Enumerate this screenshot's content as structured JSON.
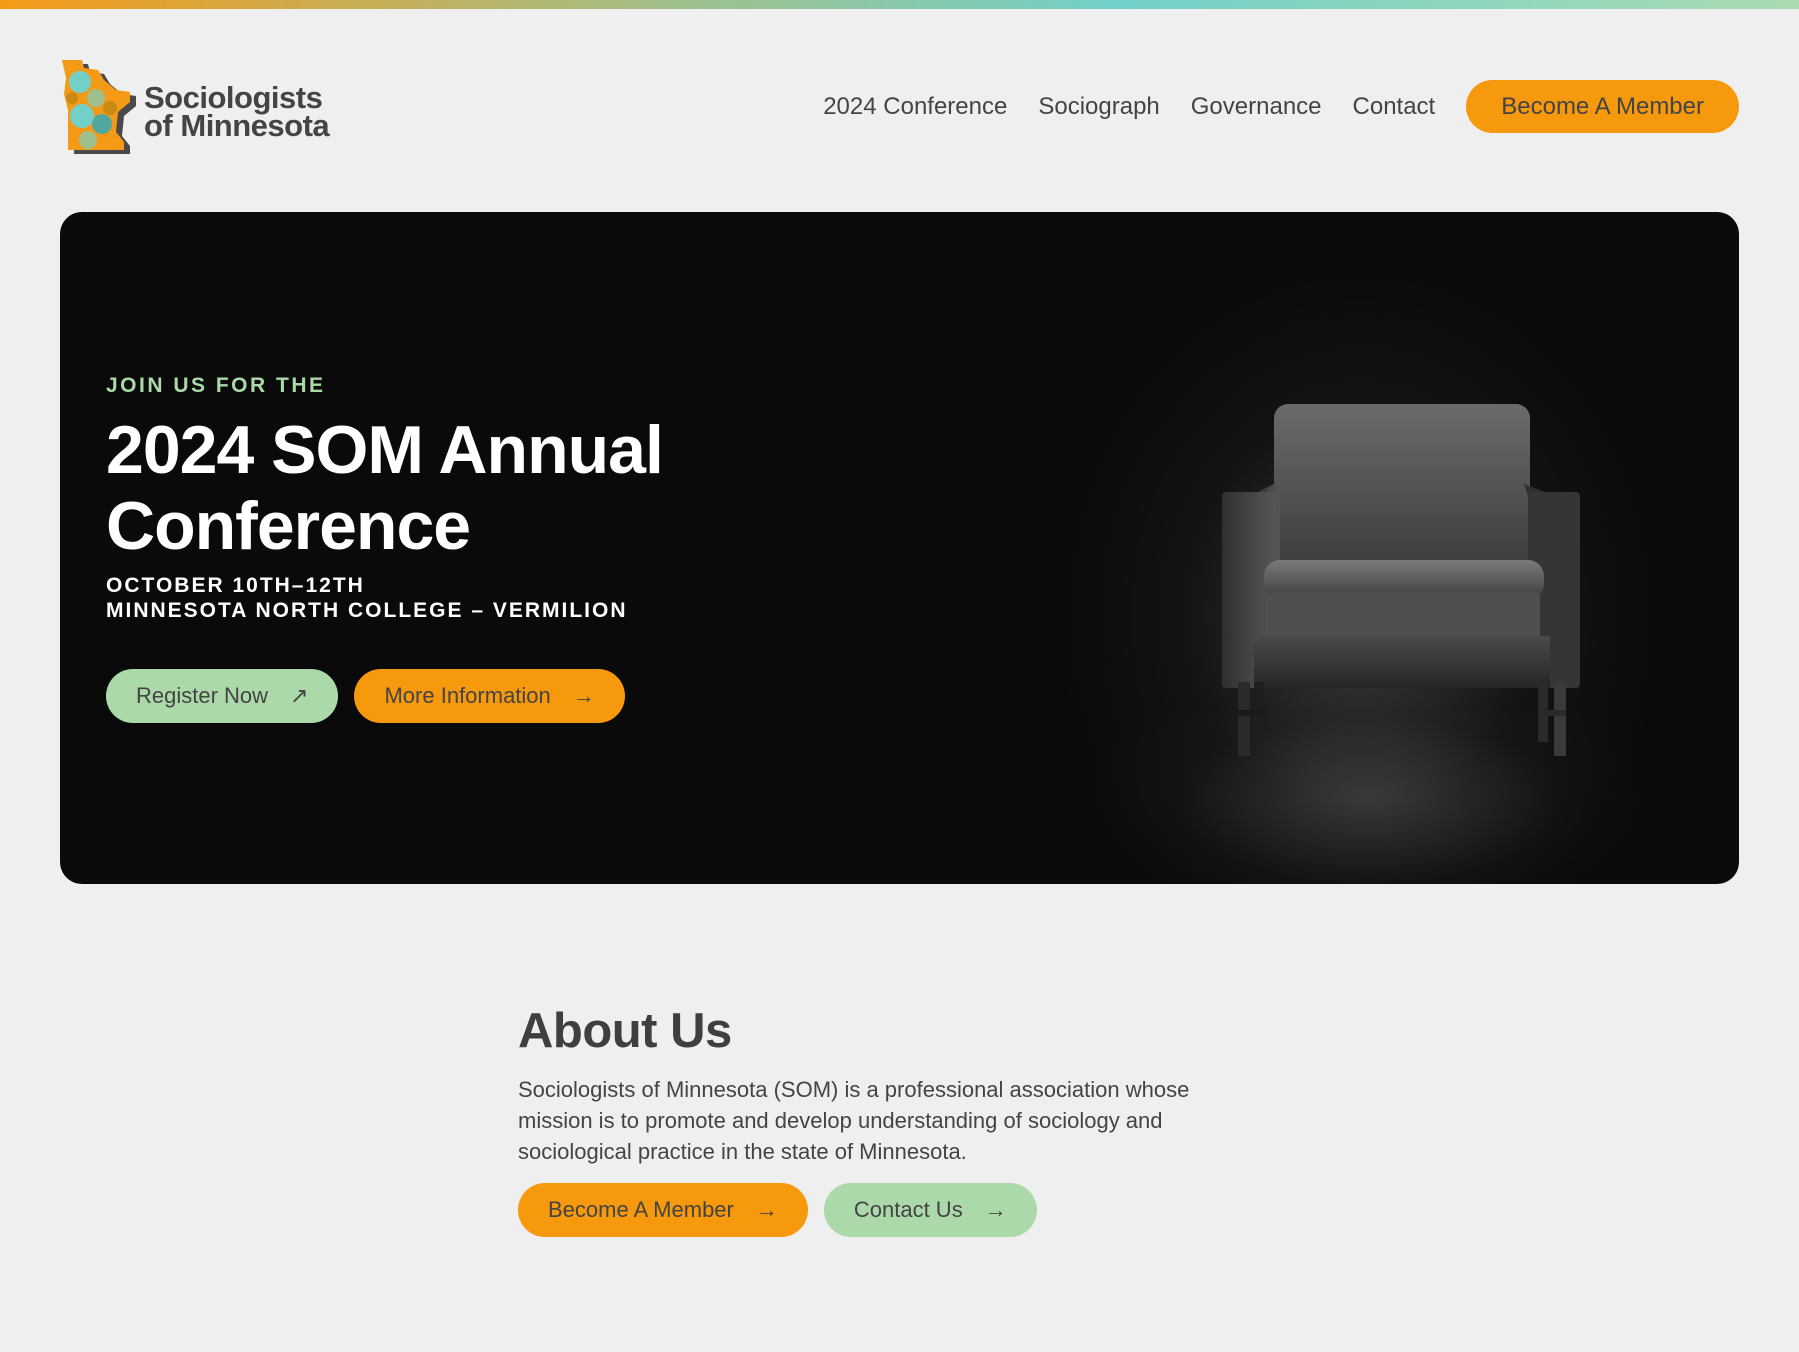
{
  "brand": {
    "name_line1": "Sociologists",
    "name_line2": "of Minnesota",
    "colors": {
      "orange": "#f7990d",
      "green": "#acd9a9",
      "teal": "#72d0c8",
      "text": "#444444",
      "hero_bg": "#0a0a0b"
    }
  },
  "nav": {
    "links": [
      "2024 Conference",
      "Sociograph",
      "Governance",
      "Contact"
    ],
    "cta": "Become A Member"
  },
  "hero": {
    "eyebrow": "JOIN US FOR THE",
    "title": "2024 SOM Annual Conference",
    "date": "OCTOBER 10TH–12TH",
    "venue": "MINNESOTA NORTH COLLEGE – VERMILION",
    "register_label": "Register Now",
    "register_icon": "arrow-up-right-icon",
    "more_label": "More Information",
    "more_icon": "arrow-right-icon"
  },
  "about": {
    "title": "About Us",
    "text": "Sociologists of Minnesota (SOM) is a professional association whose mission is to promote and develop understanding of sociology and sociological practice in the state of Minnesota.",
    "member_label": "Become A Member",
    "contact_label": "Contact Us"
  }
}
